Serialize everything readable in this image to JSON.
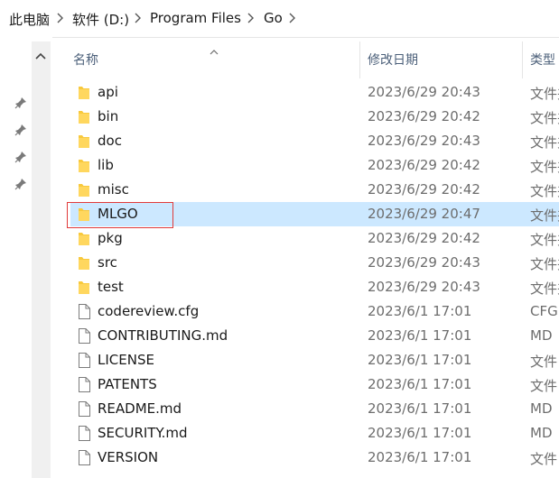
{
  "breadcrumb": {
    "items": [
      "此电脑",
      "软件 (D:)",
      "Program Files",
      "Go"
    ]
  },
  "header": {
    "name": "名称",
    "modified": "修改日期",
    "type": "类型"
  },
  "rows": [
    {
      "name": "api",
      "date": "2023/6/29 20:43",
      "type": "文件夹",
      "kind": "folder"
    },
    {
      "name": "bin",
      "date": "2023/6/29 20:42",
      "type": "文件夹",
      "kind": "folder"
    },
    {
      "name": "doc",
      "date": "2023/6/29 20:43",
      "type": "文件夹",
      "kind": "folder"
    },
    {
      "name": "lib",
      "date": "2023/6/29 20:42",
      "type": "文件夹",
      "kind": "folder"
    },
    {
      "name": "misc",
      "date": "2023/6/29 20:42",
      "type": "文件夹",
      "kind": "folder"
    },
    {
      "name": "MLGO",
      "date": "2023/6/29 20:47",
      "type": "文件夹",
      "kind": "folder",
      "selected": true
    },
    {
      "name": "pkg",
      "date": "2023/6/29 20:42",
      "type": "文件夹",
      "kind": "folder"
    },
    {
      "name": "src",
      "date": "2023/6/29 20:43",
      "type": "文件夹",
      "kind": "folder"
    },
    {
      "name": "test",
      "date": "2023/6/29 20:43",
      "type": "文件夹",
      "kind": "folder"
    },
    {
      "name": "codereview.cfg",
      "date": "2023/6/1 17:01",
      "type": "CFG",
      "kind": "file"
    },
    {
      "name": "CONTRIBUTING.md",
      "date": "2023/6/1 17:01",
      "type": "MD",
      "kind": "file"
    },
    {
      "name": "LICENSE",
      "date": "2023/6/1 17:01",
      "type": "文件",
      "kind": "file"
    },
    {
      "name": "PATENTS",
      "date": "2023/6/1 17:01",
      "type": "文件",
      "kind": "file"
    },
    {
      "name": "README.md",
      "date": "2023/6/1 17:01",
      "type": "MD",
      "kind": "file"
    },
    {
      "name": "SECURITY.md",
      "date": "2023/6/1 17:01",
      "type": "MD",
      "kind": "file"
    },
    {
      "name": "VERSION",
      "date": "2023/6/1 17:01",
      "type": "文件",
      "kind": "file"
    }
  ],
  "colors": {
    "selection": "#cce8ff",
    "highlight_box": "#e03a3a",
    "folder": "#f8c93d",
    "header_text": "#4c607a"
  },
  "icons": {
    "folder": "folder-icon",
    "file": "file-icon",
    "pin": "pin-icon",
    "separator": "chevron-right-icon",
    "scroll_up": "chevron-up-icon"
  }
}
